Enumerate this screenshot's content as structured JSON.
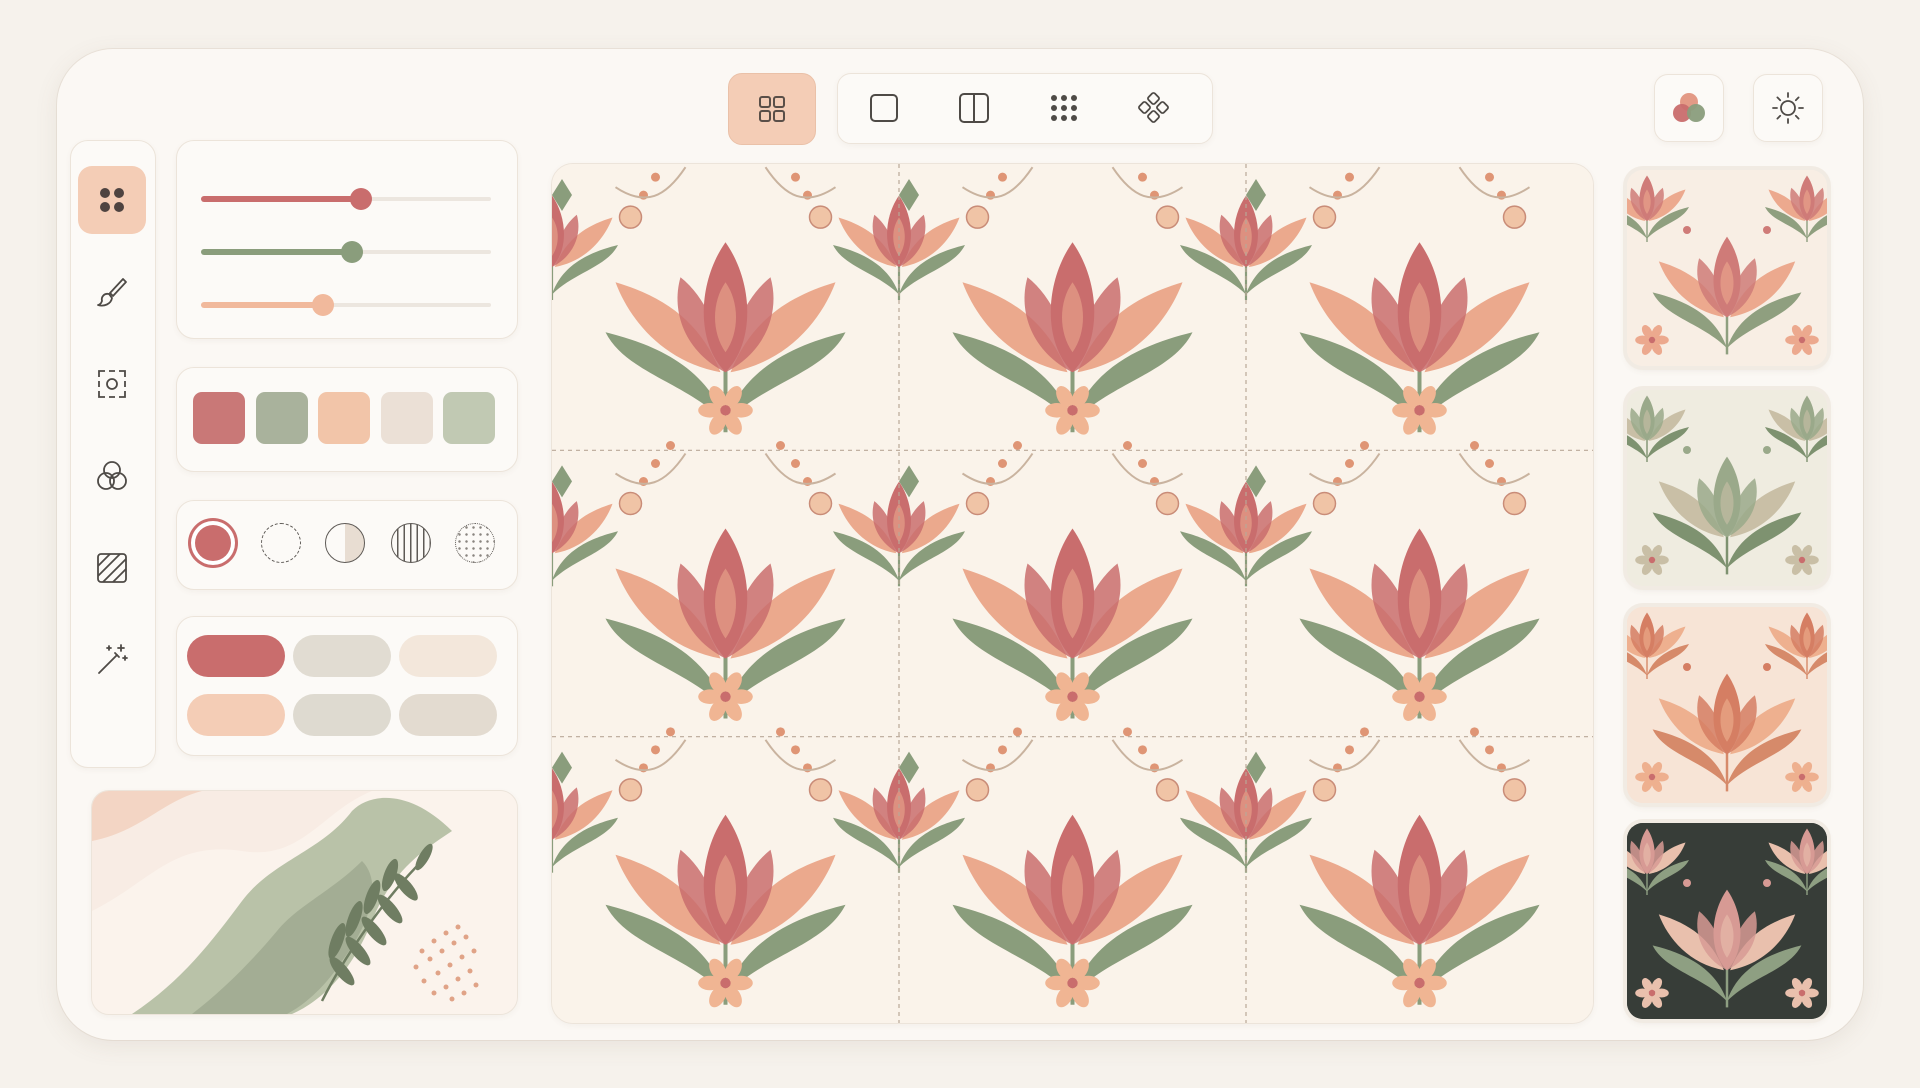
{
  "colors": {
    "rose": "#c96d6d",
    "rose_light": "#dd9892",
    "sage": "#8a9d7c",
    "sage_light": "#b7c3ab",
    "peach": "#f1c0a0",
    "sand": "#e8ddd2",
    "cream": "#faf3ea",
    "charcoal": "#353b36",
    "terracotta": "#d98b6e"
  },
  "toolbar": {
    "layout_modes": [
      {
        "name": "grid-layout",
        "icon": "four-squares-icon",
        "active": true
      },
      {
        "name": "single-tile",
        "icon": "square-icon",
        "active": false
      },
      {
        "name": "half-drop",
        "icon": "split-square-icon",
        "active": false
      },
      {
        "name": "dot-grid",
        "icon": "nine-dots-icon",
        "active": false
      },
      {
        "name": "diamond-repeat",
        "icon": "diamond-dots-icon",
        "active": false
      }
    ],
    "right_buttons": [
      {
        "name": "color-palette",
        "icon": "palette-icon"
      },
      {
        "name": "theme-toggle",
        "icon": "sun-icon"
      }
    ]
  },
  "sidebar": {
    "tools": [
      {
        "name": "motifs",
        "icon": "four-dots-icon",
        "active": true
      },
      {
        "name": "brush",
        "icon": "brush-icon",
        "active": false
      },
      {
        "name": "select",
        "icon": "selection-icon",
        "active": false
      },
      {
        "name": "blend",
        "icon": "overlap-circles-icon",
        "active": false
      },
      {
        "name": "texture",
        "icon": "hatch-square-icon",
        "active": false
      },
      {
        "name": "magic",
        "icon": "magic-wand-icon",
        "active": false
      }
    ]
  },
  "sliders": [
    {
      "name": "rose-level",
      "value": 0.55,
      "color": "#c96d6d"
    },
    {
      "name": "sage-level",
      "value": 0.52,
      "color": "#8a9d7c"
    },
    {
      "name": "peach-level",
      "value": 0.42,
      "color": "#f1b99c"
    }
  ],
  "palette": [
    "#c97877",
    "#a9b29c",
    "#f2c5a9",
    "#ebe0d6",
    "#c1c9b3"
  ],
  "brushes": [
    {
      "name": "solid",
      "active": true
    },
    {
      "name": "dashed-outline",
      "active": false
    },
    {
      "name": "half-fill",
      "active": false
    },
    {
      "name": "striped",
      "active": false
    },
    {
      "name": "stippled",
      "active": false
    }
  ],
  "pills": [
    {
      "color": "#c96d6d"
    },
    {
      "color": "#e1dcd2"
    },
    {
      "color": "#f3e7db"
    },
    {
      "color": "#f4cdb6"
    },
    {
      "color": "#dedad0"
    },
    {
      "color": "#e3dbd0"
    }
  ],
  "canvas": {
    "columns": 3,
    "rows": 3
  },
  "presets": [
    {
      "name": "cream-rose",
      "bg": "#f8eee4",
      "petal": "#cf7b78",
      "petal2": "#eca98e",
      "leaf": "#8f9f7f"
    },
    {
      "name": "sage-cream",
      "bg": "#efece0",
      "petal": "#9aa98a",
      "petal2": "#c9bfa6",
      "leaf": "#7e9270"
    },
    {
      "name": "terracotta",
      "bg": "#f7e4d6",
      "petal": "#d57e63",
      "petal2": "#eeb08f",
      "leaf": "#d68a6a"
    },
    {
      "name": "charcoal-night",
      "bg": "#373d38",
      "petal": "#d79a94",
      "petal2": "#e9c0ad",
      "leaf": "#8e9f82"
    }
  ]
}
